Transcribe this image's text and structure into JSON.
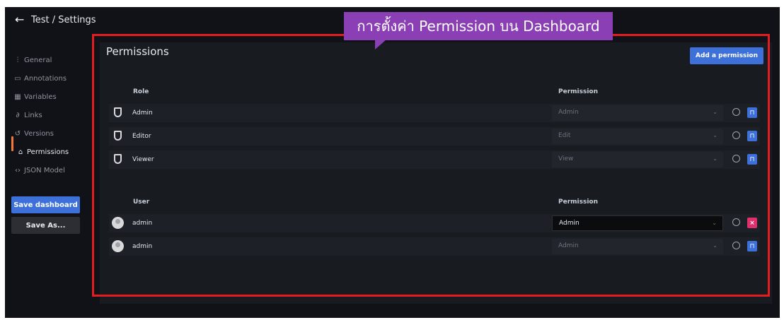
{
  "header": {
    "back_icon": "arrow-left-icon",
    "breadcrumb": "Test / Settings"
  },
  "sidebar": {
    "items": [
      {
        "label": "General",
        "icon": "sliders-icon",
        "glyph": "⫶"
      },
      {
        "label": "Annotations",
        "icon": "comment-icon",
        "glyph": "▭"
      },
      {
        "label": "Variables",
        "icon": "calculator-icon",
        "glyph": "▦"
      },
      {
        "label": "Links",
        "icon": "link-icon",
        "glyph": "∂"
      },
      {
        "label": "Versions",
        "icon": "history-icon",
        "glyph": "↺"
      },
      {
        "label": "Permissions",
        "icon": "lock-icon",
        "glyph": "⌂",
        "active": true
      },
      {
        "label": "JSON Model",
        "icon": "code-icon",
        "glyph": "‹›"
      }
    ],
    "save_dashboard": "Save dashboard",
    "save_as": "Save As..."
  },
  "main": {
    "title": "Permissions",
    "add_permission": "Add a permission",
    "role_header": "Role",
    "permission_header": "Permission",
    "user_header": "User",
    "user_permission_header": "Permission",
    "roles": [
      {
        "name": "Admin",
        "permission": "Admin"
      },
      {
        "name": "Editor",
        "permission": "Edit"
      },
      {
        "name": "Viewer",
        "permission": "View"
      }
    ],
    "users": [
      {
        "name": "admin",
        "permission": "Admin",
        "editable": true
      },
      {
        "name": "admin",
        "permission": "Admin",
        "editable": false
      }
    ]
  },
  "annotation": {
    "text": "การตั้งค่า Permission บน Dashboard",
    "color": "#8b3fb5",
    "highlight_color": "#e11d21"
  },
  "colors": {
    "primary": "#3d71d9",
    "danger": "#e02f6a",
    "active_indicator": "#f5783a"
  }
}
